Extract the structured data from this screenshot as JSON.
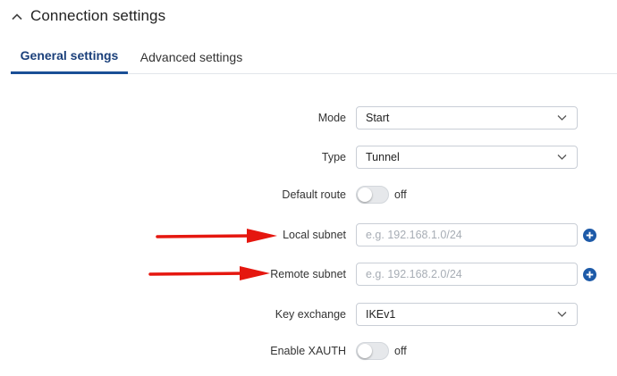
{
  "section": {
    "title": "Connection settings",
    "icon": "chevron-up-icon"
  },
  "tabs": [
    {
      "label": "General settings",
      "active": true
    },
    {
      "label": "Advanced settings",
      "active": false
    }
  ],
  "form": {
    "mode": {
      "label": "Mode",
      "value": "Start"
    },
    "type": {
      "label": "Type",
      "value": "Tunnel"
    },
    "default_route": {
      "label": "Default route",
      "state": "off"
    },
    "local_subnet": {
      "label": "Local subnet",
      "placeholder": "e.g. 192.168.1.0/24",
      "value": ""
    },
    "remote_subnet": {
      "label": "Remote subnet",
      "placeholder": "e.g. 192.168.2.0/24",
      "value": ""
    },
    "key_exchange": {
      "label": "Key exchange",
      "value": "IKEv1"
    },
    "enable_xauth": {
      "label": "Enable XAUTH",
      "state": "off"
    }
  },
  "colors": {
    "accent": "#1a4f96",
    "add_button": "#1d5aa8",
    "annotation_arrow": "#e5170f"
  }
}
